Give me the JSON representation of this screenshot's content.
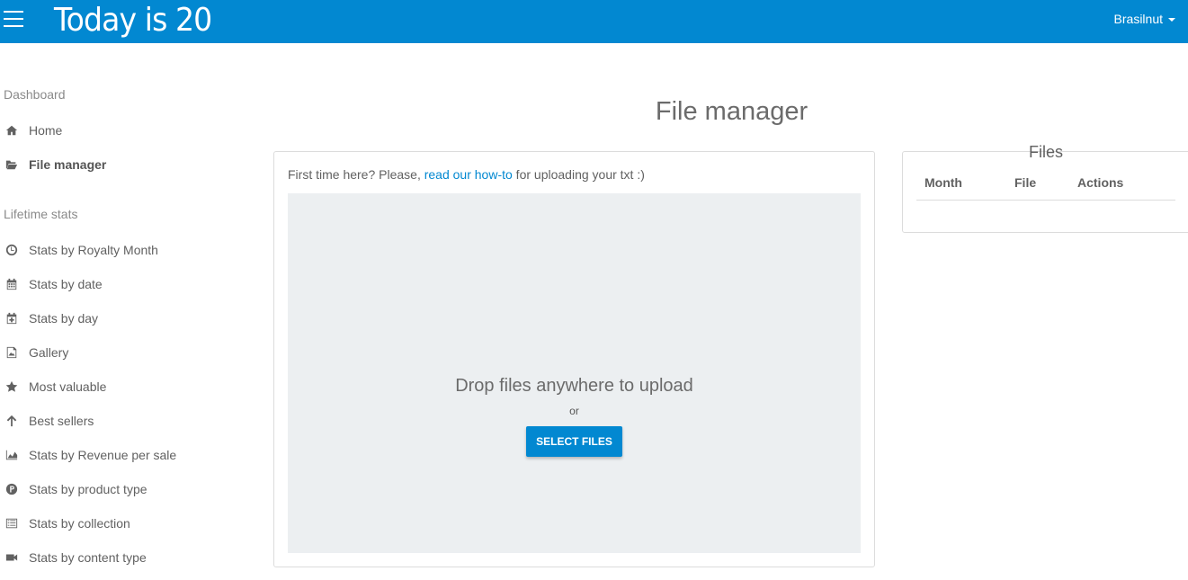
{
  "header": {
    "brand": "Today is 20",
    "user": "Brasilnut",
    "accent_color": "#0288d1"
  },
  "sidebar": {
    "sections": [
      {
        "title": "Dashboard",
        "items": [
          {
            "label": "Home",
            "icon": "home-icon"
          },
          {
            "label": "File manager",
            "icon": "folder-open-icon",
            "active": true
          }
        ]
      },
      {
        "title": "Lifetime stats",
        "items": [
          {
            "label": "Stats by Royalty Month",
            "icon": "clock-icon"
          },
          {
            "label": "Stats by date",
            "icon": "calendar-icon"
          },
          {
            "label": "Stats by day",
            "icon": "calendar-plus-icon"
          },
          {
            "label": "Gallery",
            "icon": "image-icon"
          },
          {
            "label": "Most valuable",
            "icon": "star-icon"
          },
          {
            "label": "Best sellers",
            "icon": "arrow-up-icon"
          },
          {
            "label": "Stats by Revenue per sale",
            "icon": "area-chart-icon"
          },
          {
            "label": "Stats by product type",
            "icon": "product-p-icon"
          },
          {
            "label": "Stats by collection",
            "icon": "list-alt-icon"
          },
          {
            "label": "Stats by content type",
            "icon": "video-camera-icon"
          }
        ]
      }
    ]
  },
  "main": {
    "title": "File manager",
    "intro_prefix": "First time here? Please, ",
    "intro_link": "read our how-to",
    "intro_suffix": " for uploading your txt :)",
    "dropzone": {
      "text": "Drop files anywhere to upload",
      "or": "or",
      "button": "SELECT FILES"
    }
  },
  "files": {
    "title": "Files",
    "columns": [
      "Month",
      "File",
      "Actions"
    ]
  }
}
